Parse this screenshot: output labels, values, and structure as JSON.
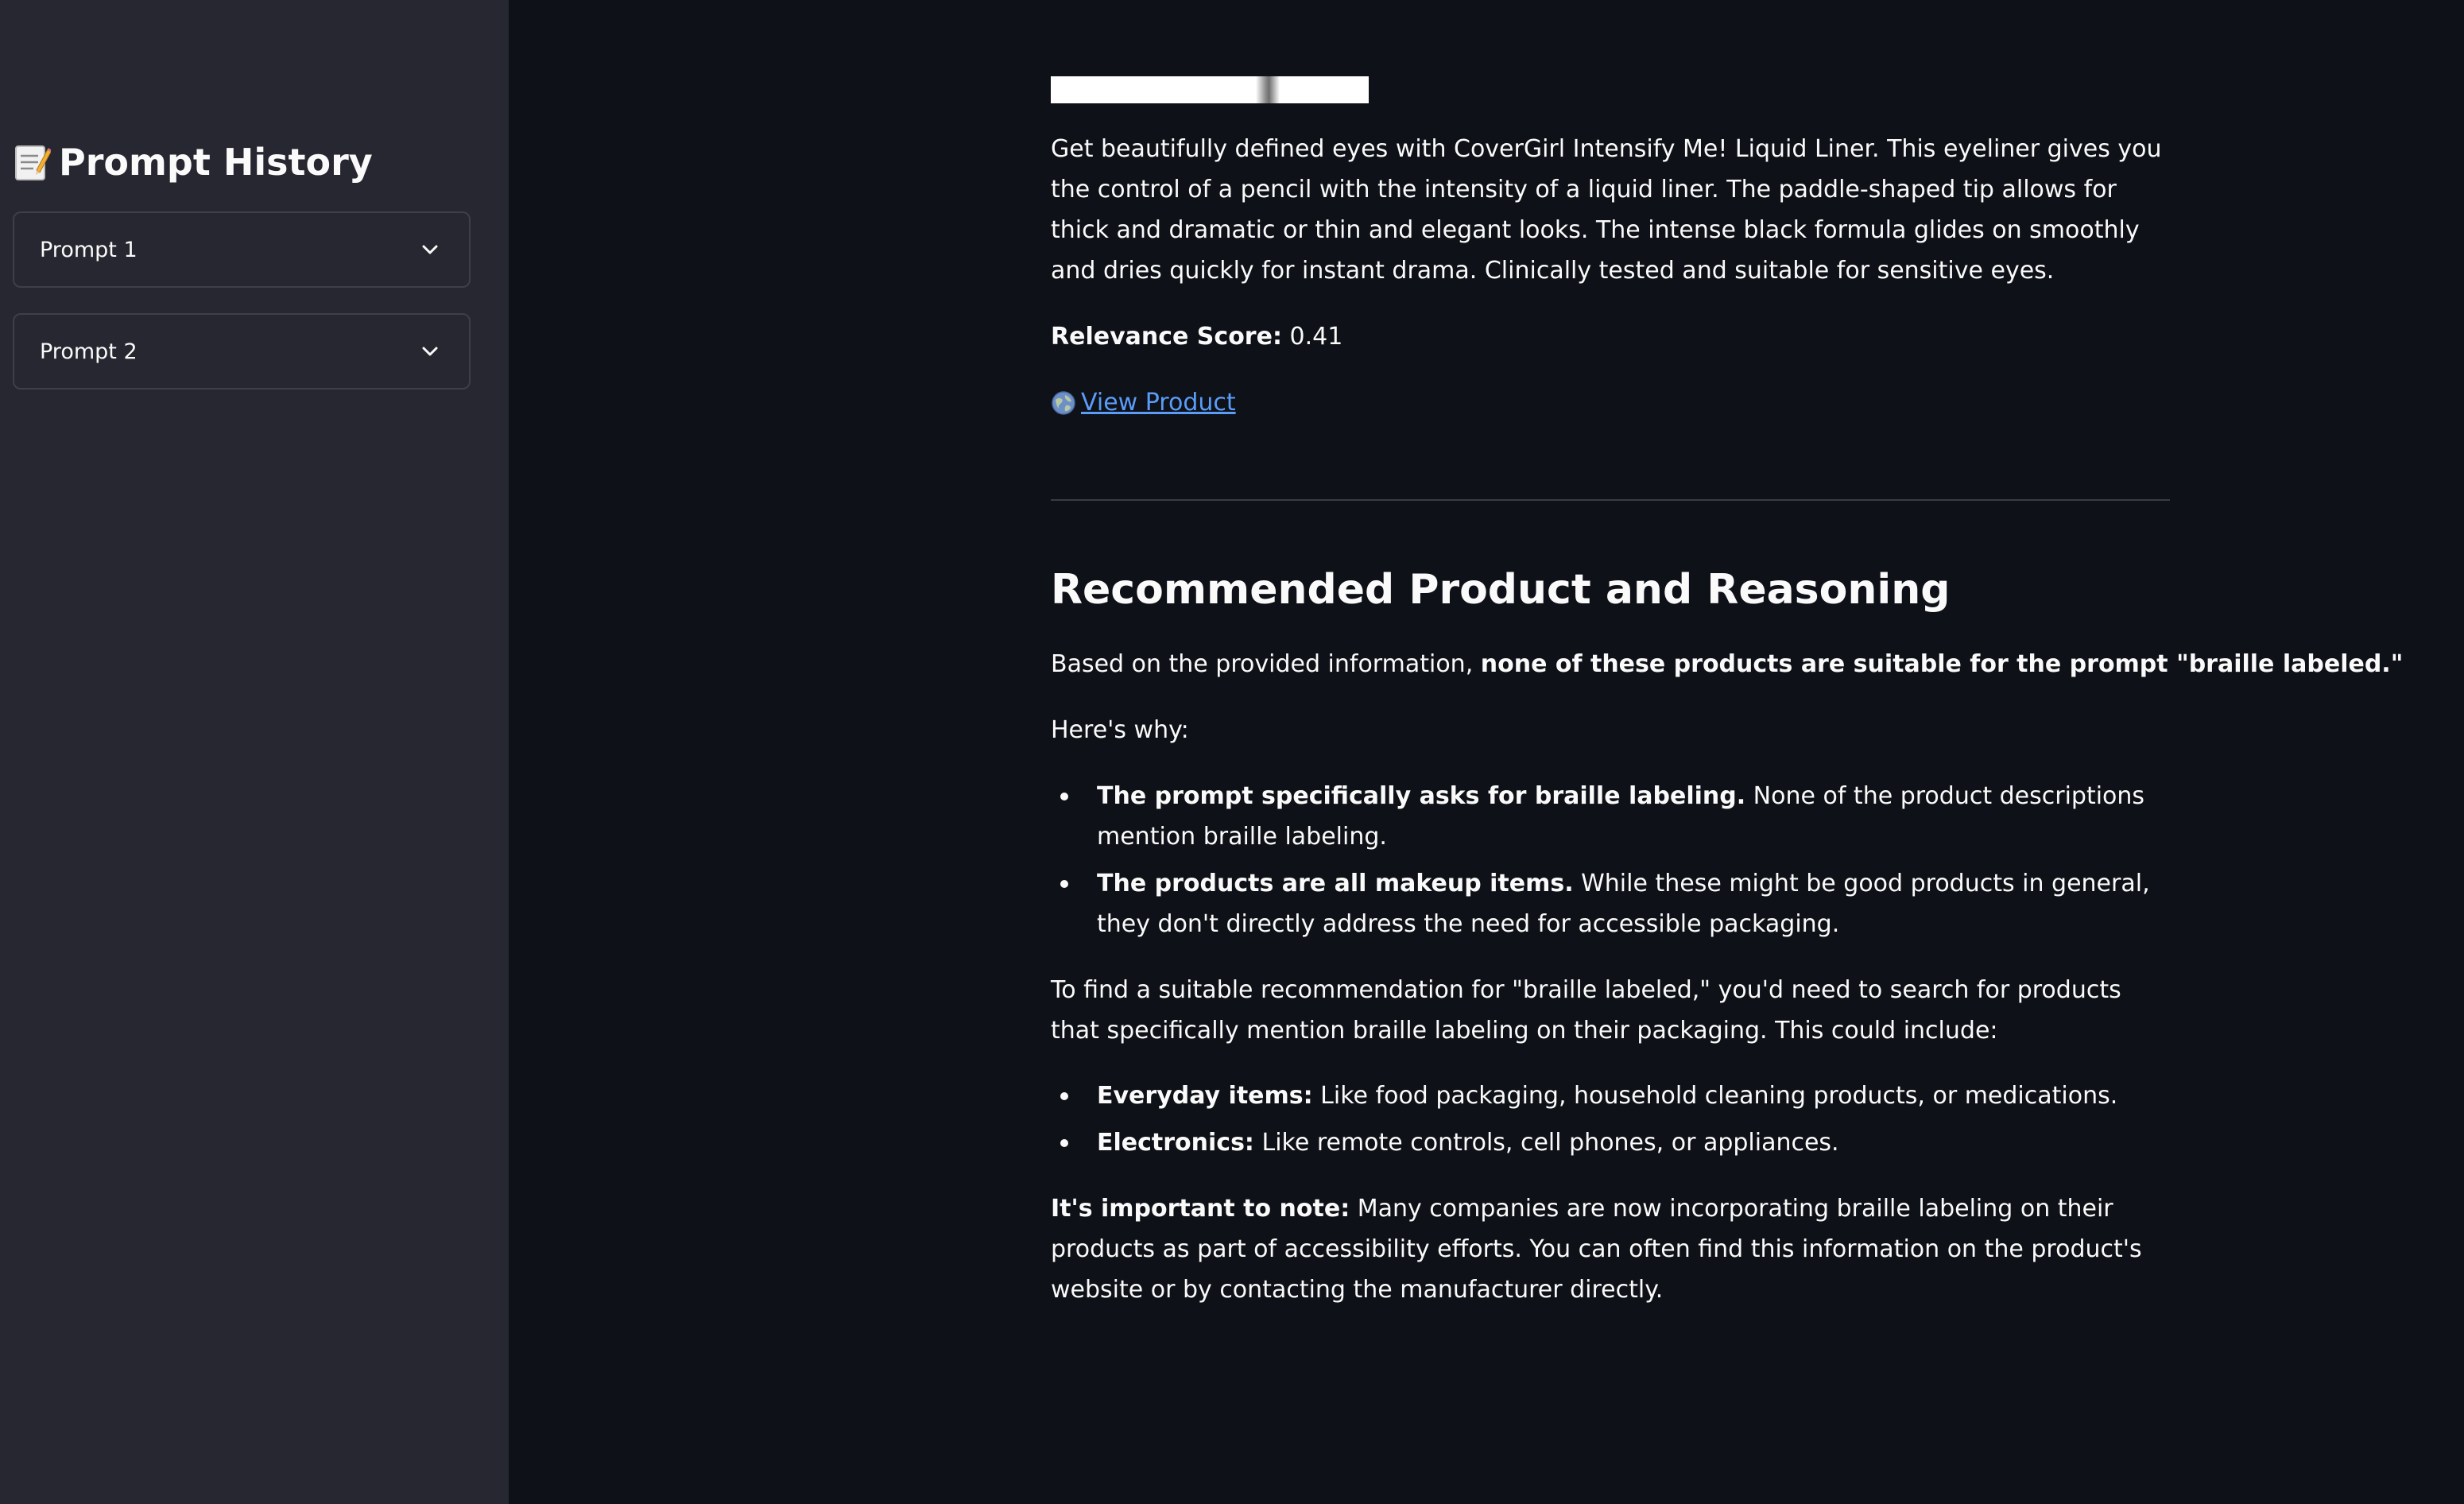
{
  "sidebar": {
    "title": "Prompt History",
    "title_icon": "memo-icon",
    "expanders": [
      {
        "label": "Prompt 1",
        "icon": "chevron-down-icon"
      },
      {
        "label": "Prompt 2",
        "icon": "chevron-down-icon"
      }
    ]
  },
  "product": {
    "description": "Get beautifully defined eyes with CoverGirl Intensify Me! Liquid Liner. This eyeliner gives you the control of a pencil with the intensity of a liquid liner. The paddle-shaped tip allows for thick and dramatic or thin and elegant looks. The intense black formula glides on smoothly and dries quickly for instant drama. Clinically tested and suitable for sensitive eyes.",
    "score_label": "Relevance Score:",
    "score_value": " 0.41",
    "link_icon": "globe-icon",
    "link_label": "View Product"
  },
  "recommendation": {
    "heading": "Recommended Product and Reasoning",
    "intro_prefix": "Based on the provided information, ",
    "intro_bold": "none of these products are suitable for the prompt \"braille labeled.\"",
    "why": "Here's why:",
    "reasons": [
      {
        "bold": "The prompt specifically asks for braille labeling.",
        "text": " None of the product descriptions mention braille labeling."
      },
      {
        "bold": "The products are all makeup items.",
        "text": " While these might be good products in general, they don't directly address the need for accessible packaging."
      }
    ],
    "find": "To find a suitable recommendation for \"braille labeled,\" you'd need to search for products that specifically mention braille labeling on their packaging. This could include:",
    "examples": [
      {
        "bold": "Everyday items:",
        "text": " Like food packaging, household cleaning products, or medications."
      },
      {
        "bold": "Electronics:",
        "text": " Like remote controls, cell phones, or appliances."
      }
    ],
    "note_bold": "It's important to note:",
    "note_text": " Many companies are now incorporating braille labeling on their products as part of accessibility efforts. You can often find this information on the product's website or by contacting the manufacturer directly."
  },
  "colors": {
    "background": "#0e1117",
    "sidebar": "#262730",
    "link": "#5a9cf8",
    "text": "#fafafa"
  }
}
